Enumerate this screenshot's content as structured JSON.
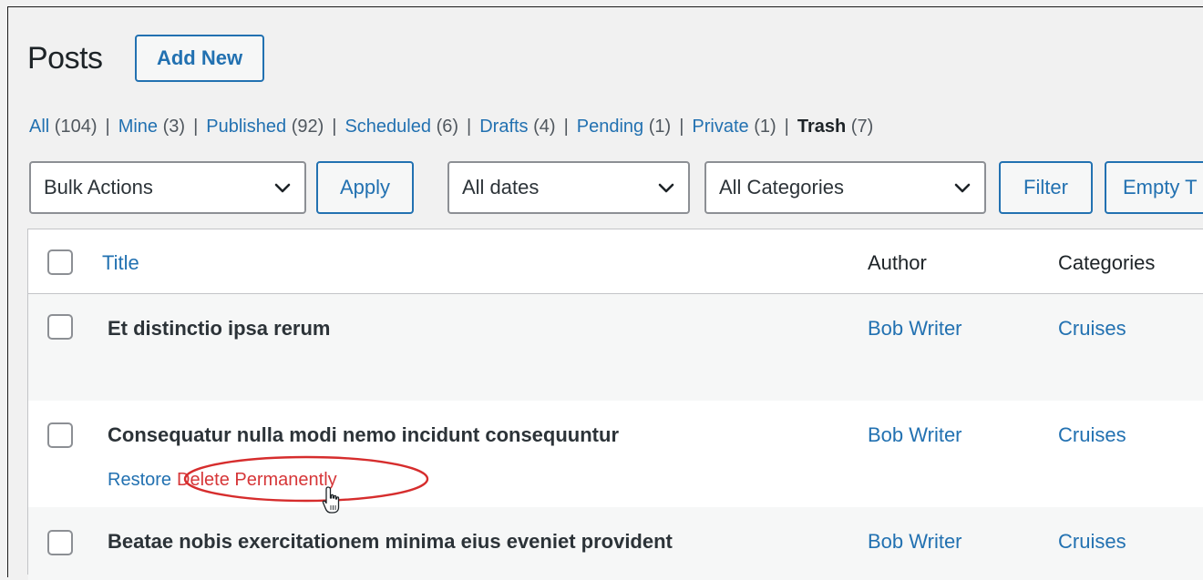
{
  "page": {
    "title": "Posts",
    "add_new_label": "Add New"
  },
  "filters": {
    "views": [
      {
        "label": "All",
        "count": "(104)"
      },
      {
        "label": "Mine",
        "count": "(3)"
      },
      {
        "label": "Published",
        "count": "(92)"
      },
      {
        "label": "Scheduled",
        "count": "(6)"
      },
      {
        "label": "Drafts",
        "count": "(4)"
      },
      {
        "label": "Pending",
        "count": "(1)"
      },
      {
        "label": "Private",
        "count": "(1)"
      },
      {
        "label": "Trash",
        "count": "(7)",
        "current": true
      }
    ],
    "separator": "|"
  },
  "toolbar": {
    "bulk_actions": "Bulk Actions",
    "apply_label": "Apply",
    "dates_select": "All dates",
    "categories_select": "All Categories",
    "filter_label": "Filter",
    "empty_trash_label": "Empty T"
  },
  "table": {
    "columns": {
      "title": "Title",
      "author": "Author",
      "categories": "Categories"
    },
    "rows": [
      {
        "title": "Et distinctio ipsa rerum",
        "author": "Bob Writer",
        "category": "Cruises"
      },
      {
        "title": "Consequatur nulla modi nemo incidunt consequuntur",
        "author": "Bob Writer",
        "category": "Cruises",
        "actions": {
          "restore": "Restore",
          "delete": "Delete Permanently"
        }
      },
      {
        "title": "Beatae nobis exercitationem minima eius eveniet provident",
        "author": "Bob Writer",
        "category": "Cruises"
      }
    ]
  },
  "colors": {
    "link": "#2271b1",
    "delete": "#d63638",
    "annotation_circle": "#d62d2d"
  }
}
